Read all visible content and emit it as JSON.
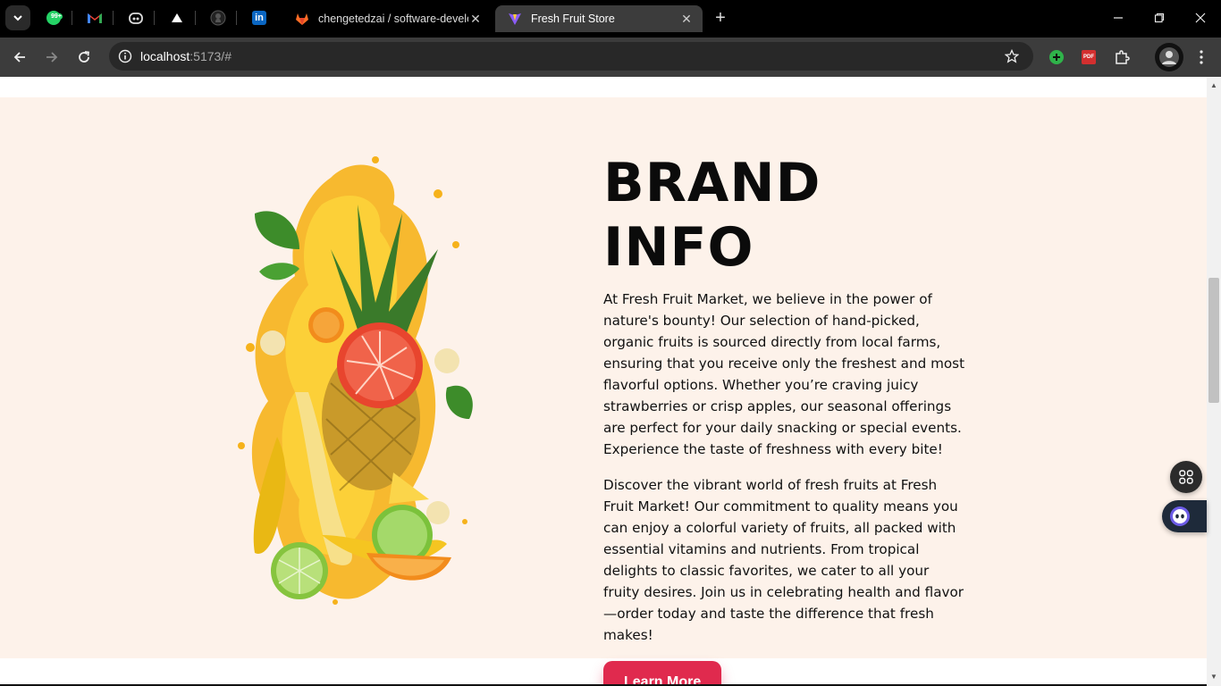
{
  "browser": {
    "tabs": [
      {
        "title": "chengetedzai / software-develo",
        "active": false,
        "favicon": "gitlab-icon"
      },
      {
        "title": "Fresh Fruit Store",
        "active": true,
        "favicon": "vite-icon"
      }
    ],
    "pinned_tabs": [
      "whatsapp-icon",
      "gmail-icon",
      "copilot-icon",
      "vercel-icon",
      "github-icon",
      "linkedin-icon"
    ],
    "whatsapp_badge": "99+",
    "linkedin_text": "in",
    "address": {
      "host": "localhost",
      "path": ":5173/#"
    },
    "pdf_ext_label": "PDF"
  },
  "page": {
    "title": "BRAND INFO",
    "paragraphs": [
      "At Fresh Fruit Market, we believe in the power of nature's bounty! Our selection of hand-picked, organic fruits is sourced directly from local farms, ensuring that you receive only the freshest and most flavorful options. Whether you’re craving juicy strawberries or crisp apples, our seasonal offerings are perfect for your daily snacking or special events. Experience the taste of freshness with every bite!",
      "Discover the vibrant world of fresh fruits at Fresh Fruit Market! Our commitment to quality means you can enjoy a colorful variety of fruits, all packed with essential vitamins and nutrients. From tropical delights to classic favorites, we cater to all your fruity desires. Join us in celebrating health and flavor—order today and taste the difference that fresh makes!"
    ],
    "cta_label": "Learn More",
    "accent": "#e02a4e",
    "section_bg": "#fdf2ea"
  }
}
